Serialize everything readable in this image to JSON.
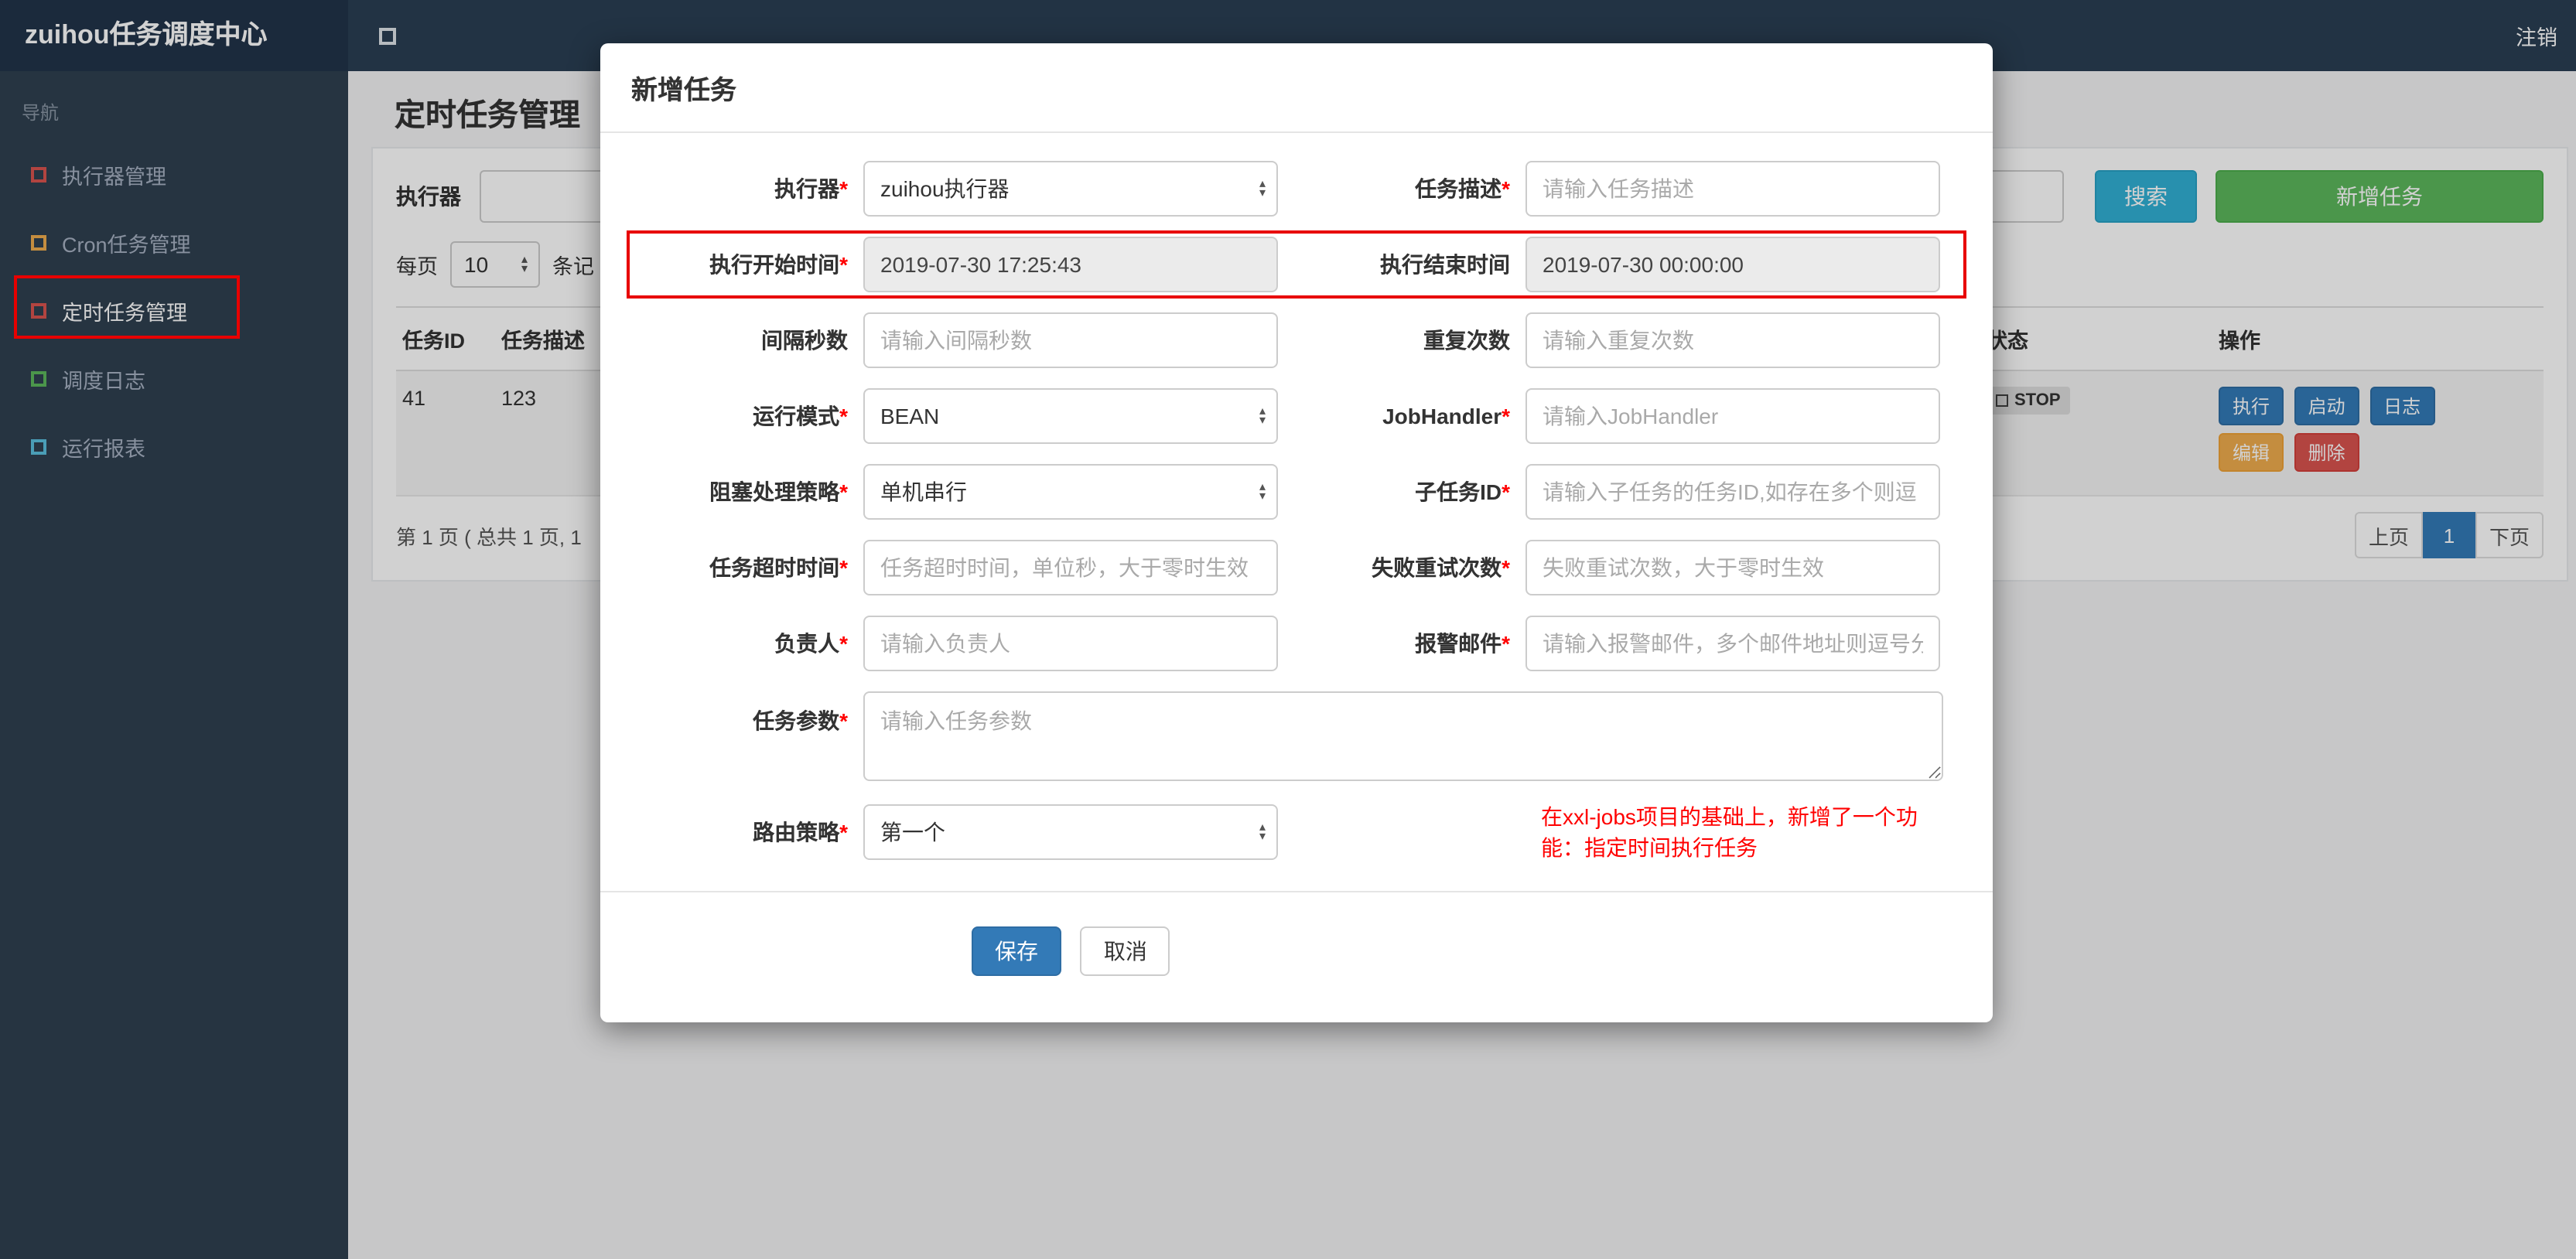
{
  "colors": {
    "topbar": "#2a3f54",
    "sidebar": "#2f4050",
    "accent_blue": "#337ab7",
    "search_teal": "#31b0d5",
    "add_green": "#5cb85c",
    "edit_orange": "#f0ad4e",
    "delete_red": "#d9534f",
    "annotation_red": "#e80000"
  },
  "icons": {
    "collapse": "square-outline",
    "menu_bullet": "square-outline",
    "status_square": "square-outline",
    "stepper_up": "▴",
    "stepper_down": "▾"
  },
  "navbar": {
    "brand": "zuihou任务调度中心",
    "logout": "注销"
  },
  "sidebar": {
    "nav_label": "导航",
    "items": [
      {
        "label": "执行器管理",
        "icon_color": "#d9534f"
      },
      {
        "label": "Cron任务管理",
        "icon_color": "#f0ad4e"
      },
      {
        "label": "定时任务管理",
        "icon_color": "#d9534f"
      },
      {
        "label": "调度日志",
        "icon_color": "#5cb85c"
      },
      {
        "label": "运行报表",
        "icon_color": "#5bc0de"
      }
    ]
  },
  "page": {
    "title": "定时任务管理",
    "filter": {
      "executor_label": "执行器",
      "search_button": "搜索",
      "add_button": "新增任务"
    },
    "per_page": {
      "prefix": "每页",
      "value": "10",
      "suffix": "条记"
    },
    "table": {
      "headers": {
        "id": "任务ID",
        "desc": "任务描述",
        "status": "状态",
        "actions": "操作"
      },
      "row": {
        "id": "41",
        "desc": "123",
        "status": "STOP",
        "actions": {
          "run": "执行",
          "start": "启动",
          "log": "日志",
          "edit": "编辑",
          "delete": "删除"
        }
      }
    },
    "pagination": {
      "info": "第 1 页 ( 总共 1 页, 1",
      "prev": "上页",
      "page": "1",
      "next": "下页"
    }
  },
  "modal": {
    "title": "新增任务",
    "rows": [
      {
        "left": {
          "label": "执行器",
          "mark": "*",
          "value": "zuihou执行器"
        },
        "right": {
          "label": "任务描述",
          "mark": "*",
          "placeholder": "请输入任务描述"
        }
      },
      {
        "left": {
          "label": "执行开始时间",
          "mark": "*",
          "value": "2019-07-30 17:25:43"
        },
        "right": {
          "label": "执行结束时间",
          "mark": "",
          "value": "2019-07-30 00:00:00"
        }
      },
      {
        "left": {
          "label": "间隔秒数",
          "mark": "",
          "placeholder": "请输入间隔秒数"
        },
        "right": {
          "label": "重复次数",
          "mark": "",
          "placeholder": "请输入重复次数"
        }
      },
      {
        "left": {
          "label": "运行模式",
          "mark": "*",
          "value": "BEAN"
        },
        "right": {
          "label": "JobHandler",
          "mark": "*",
          "placeholder": "请输入JobHandler"
        }
      },
      {
        "left": {
          "label": "阻塞处理策略",
          "mark": "*",
          "value": "单机串行"
        },
        "right": {
          "label": "子任务ID",
          "mark": "*",
          "placeholder": "请输入子任务的任务ID,如存在多个则逗"
        }
      },
      {
        "left": {
          "label": "任务超时时间",
          "mark": "*",
          "placeholder": "任务超时时间，单位秒，大于零时生效"
        },
        "right": {
          "label": "失败重试次数",
          "mark": "*",
          "placeholder": "失败重试次数，大于零时生效"
        }
      },
      {
        "left": {
          "label": "负责人",
          "mark": "*",
          "placeholder": "请输入负责人"
        },
        "right": {
          "label": "报警邮件",
          "mark": "*",
          "placeholder": "请输入报警邮件，多个邮件地址则逗号分"
        }
      }
    ],
    "params": {
      "label": "任务参数",
      "mark": "*",
      "placeholder": "请输入任务参数"
    },
    "route": {
      "label": "路由策略",
      "mark": "*",
      "value": "第一个"
    },
    "note": "在xxl-jobs项目的基础上，新增了一个功能：指定时间执行任务",
    "save": "保存",
    "cancel": "取消"
  }
}
